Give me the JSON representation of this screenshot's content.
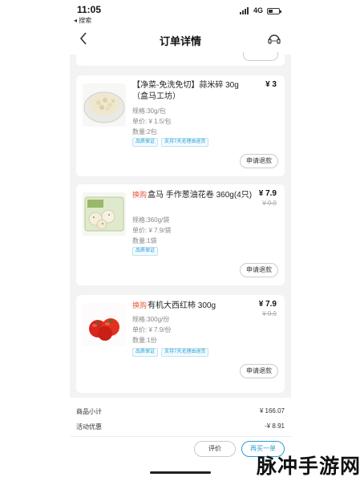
{
  "status_bar": {
    "time": "11:05",
    "back_app": "◂ 搜索",
    "network": "4G"
  },
  "navbar": {
    "title": "订单详情"
  },
  "items": [
    {
      "tag": "",
      "name": "【净菜-免洗免切】蒜米碎 30g（盒马工坊）",
      "price": "¥ 3",
      "original_price": "",
      "spec": "规格:30g/包",
      "unit_price": "单价: ¥ 1.5/包",
      "quantity": "数量:2包",
      "badges": [
        "品质保证",
        "支持7天无理由退货"
      ],
      "refund_label": "申请退款"
    },
    {
      "tag": "换购",
      "name": "盒马 手作葱油花卷 360g(4只)",
      "price": "¥ 7.9",
      "original_price": "¥ 9.9",
      "spec": "规格:360g/袋",
      "unit_price": "单价: ¥ 7.9/袋",
      "quantity": "数量:1袋",
      "badges": [
        "品质保证"
      ],
      "refund_label": "申请退款"
    },
    {
      "tag": "换购",
      "name": "有机大西红柿 300g",
      "price": "¥ 7.9",
      "original_price": "¥ 9.9",
      "spec": "规格:300g/份",
      "unit_price": "单价: ¥ 7.9/份",
      "quantity": "数量:1份",
      "badges": [
        "品质保证",
        "支持7天无理由退货"
      ],
      "refund_label": "申请退款"
    }
  ],
  "summary": {
    "subtotal_label": "商品小计",
    "subtotal_value": "¥ 166.07",
    "discount_label": "活动优惠",
    "discount_value": "-¥ 8.91"
  },
  "actions": {
    "evaluate_label": "评价",
    "buy_again_label": "再买一单"
  },
  "watermark": {
    "text": "脉冲手游网"
  }
}
